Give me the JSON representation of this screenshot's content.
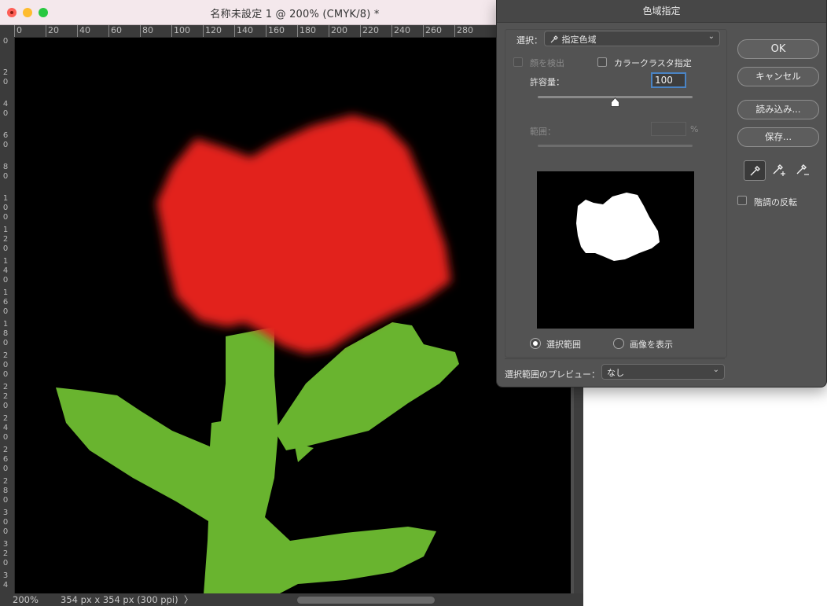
{
  "document": {
    "title": "名称未設定 1 @ 200% (CMYK/8) *",
    "ruler_h_labels": [
      "0",
      "20",
      "40",
      "60",
      "80",
      "100",
      "120",
      "140",
      "160",
      "180",
      "200",
      "220",
      "240",
      "260",
      "280"
    ],
    "ruler_v_labels": [
      "0",
      "20",
      "40",
      "60",
      "80",
      "100",
      "120",
      "140",
      "160",
      "180",
      "200",
      "220",
      "240",
      "260",
      "280",
      "300",
      "320",
      "34"
    ],
    "zoom": "200%",
    "size_info": "354 px x 354 px (300 ppi)",
    "status_arrow": "〉"
  },
  "dialog": {
    "title": "色域指定",
    "select_label": "選択：",
    "select_value": "指定色域",
    "face_detect_label": "顔を検出",
    "cluster_label": "カラークラスタ指定",
    "tolerance_label": "許容量：",
    "tolerance_value": "100",
    "tolerance_slider_fraction": 0.5,
    "range_label": "範囲：",
    "range_value": "",
    "range_unit": "%",
    "radio_selection": "選択範囲",
    "radio_image": "画像を表示",
    "preview_label": "選択範囲のプレビュー：",
    "preview_value": "なし",
    "invert_label": "階調の反転",
    "buttons": {
      "ok": "OK",
      "cancel": "キャンセル",
      "load": "読み込み...",
      "save": "保存..."
    }
  },
  "colors": {
    "flower_red": "#e2231a",
    "stem_green": "#69b42f",
    "dialog_bg": "#535353",
    "focus_blue": "#4a84c5"
  }
}
